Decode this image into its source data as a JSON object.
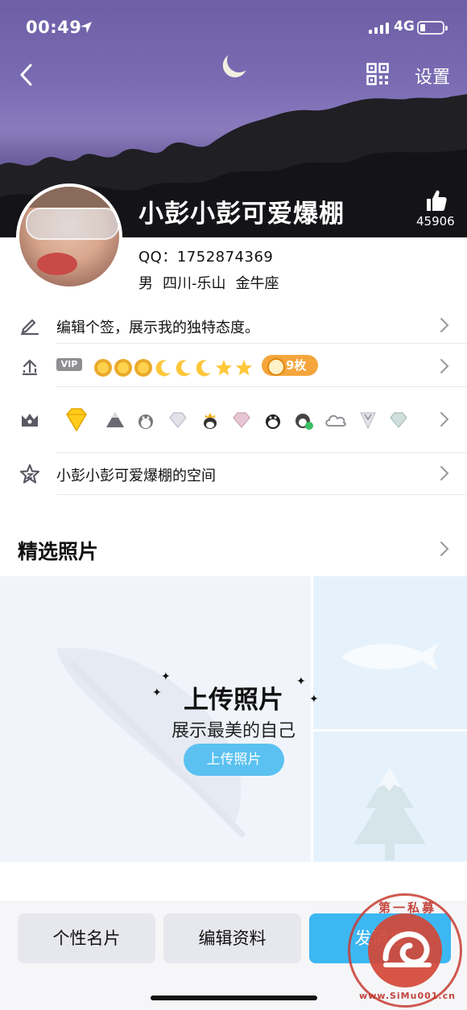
{
  "status_bar": {
    "time": "00:49",
    "network": "4G"
  },
  "header": {
    "settings_label": "设置",
    "nickname": "小彭小彭可爱爆棚",
    "like_count": "45906"
  },
  "profile": {
    "qq": "QQ：1752874369",
    "gender": "男",
    "location": "四川-乐山",
    "zodiac": "金牛座"
  },
  "rows": {
    "signature": "编辑个签，展示我的独特态度。",
    "vip_label": "VIP",
    "coins": "9枚",
    "space": "小彭小彭可爱爆棚的空间"
  },
  "photos": {
    "section_title": "精选照片",
    "upload_title": "上传照片",
    "upload_subtitle": "展示最美的自己",
    "upload_button": "上传照片"
  },
  "bottom_bar": {
    "card_label": "个性名片",
    "edit_label": "编辑资料",
    "share_label": "发消息"
  },
  "watermark": {
    "top": "第一私募",
    "bottom": "www.SiMu001.cn"
  },
  "colors": {
    "accent": "#3cb7f2",
    "upload_button": "#5ac1f0",
    "coin": "#f4a53c"
  }
}
